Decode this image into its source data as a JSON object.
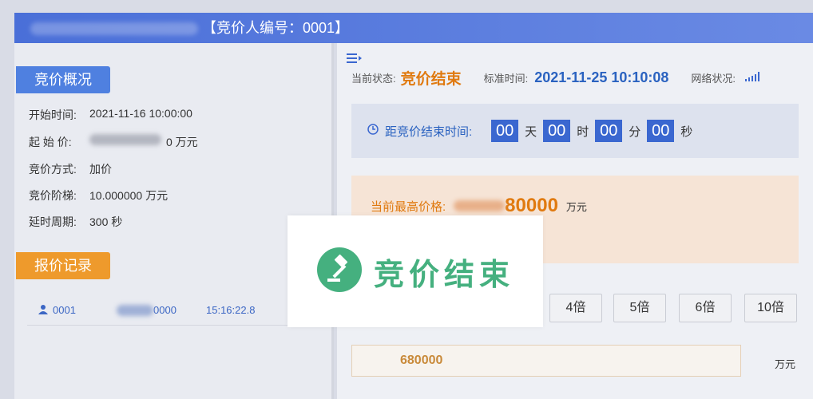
{
  "header": {
    "title_suffix": "【竞价人编号：0001】"
  },
  "left": {
    "overview_tag": "竞价概况",
    "info": [
      {
        "label": "开始时间:",
        "value": "2021-11-16 10:00:00"
      },
      {
        "label": "起 始 价:",
        "value": "0 万元"
      },
      {
        "label": "竞价方式:",
        "value": "加价"
      },
      {
        "label": "竞价阶梯:",
        "value": "10.000000 万元"
      },
      {
        "label": "延时周期:",
        "value": "300 秒"
      }
    ],
    "record_tag": "报价记录",
    "record": {
      "bidder": "0001",
      "price": "0000",
      "time": "15:16:22.8"
    }
  },
  "status": {
    "state_label": "当前状态:",
    "state_value": "竞价结束",
    "time_label": "标准时间:",
    "time_value": "2021-11-25 10:10:08",
    "network_label": "网络状况:"
  },
  "countdown": {
    "label": "距竞价结束时间:",
    "days": "00",
    "day_unit": "天",
    "hours": "00",
    "hour_unit": "时",
    "minutes": "00",
    "minute_unit": "分",
    "seconds": "00",
    "second_unit": "秒"
  },
  "price": {
    "label": "当前最高价格:",
    "value": "80000",
    "unit": "万元"
  },
  "multipliers": [
    "4倍",
    "5倍",
    "6倍",
    "10倍"
  ],
  "bid_input": {
    "value": "680000",
    "unit": "万元"
  },
  "overlay": {
    "text": "竞价结束"
  },
  "colors": {
    "accent_orange": "#e07a10",
    "accent_blue": "#2a62c0",
    "ended_green": "#45b07f"
  }
}
